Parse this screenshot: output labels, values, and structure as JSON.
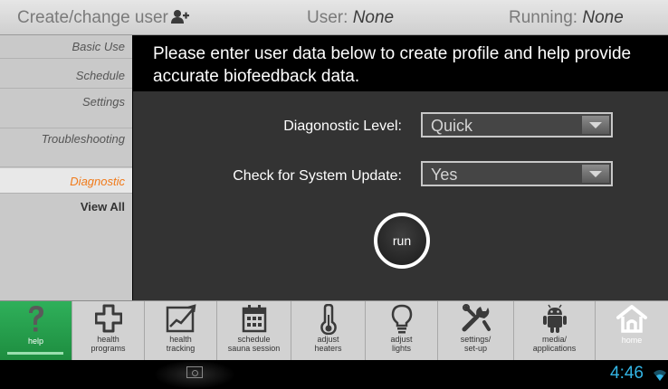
{
  "header": {
    "create_label": "Create/change user",
    "user_label": "User:",
    "user_value": "None",
    "running_label": "Running:",
    "running_value": "None"
  },
  "sidebar": {
    "items": [
      {
        "label": "Basic Use"
      },
      {
        "label": "Schedule"
      },
      {
        "label": "Settings"
      },
      {
        "label": "Troubleshooting"
      },
      {
        "label": "Diagnostic",
        "active": true
      },
      {
        "label": "View All"
      }
    ]
  },
  "main": {
    "intro": "Please enter user data below to create profile and help provide accurate biofeedback data.",
    "diagnostic_level_label": "Diagonostic Level:",
    "diagnostic_level_value": "Quick",
    "system_update_label": "Check for System Update:",
    "system_update_value": "Yes",
    "run_label": "run"
  },
  "nav": {
    "items": [
      {
        "label": "help",
        "icon": "question-icon"
      },
      {
        "label": "health\nprograms",
        "icon": "cross-icon"
      },
      {
        "label": "health\ntracking",
        "icon": "chart-icon"
      },
      {
        "label": "schedule\nsauna session",
        "icon": "calendar-icon"
      },
      {
        "label": "adjust\nheaters",
        "icon": "thermometer-icon"
      },
      {
        "label": "adjust\nlights",
        "icon": "bulb-icon"
      },
      {
        "label": "settings/\nset-up",
        "icon": "tools-icon"
      },
      {
        "label": "media/\napplications",
        "icon": "android-icon"
      },
      {
        "label": "home",
        "icon": "home-icon"
      }
    ]
  },
  "system": {
    "time": "4:46"
  },
  "colors": {
    "accent_orange": "#f07a1a",
    "help_green": "#27a04e",
    "clock_blue": "#33b5e5"
  }
}
